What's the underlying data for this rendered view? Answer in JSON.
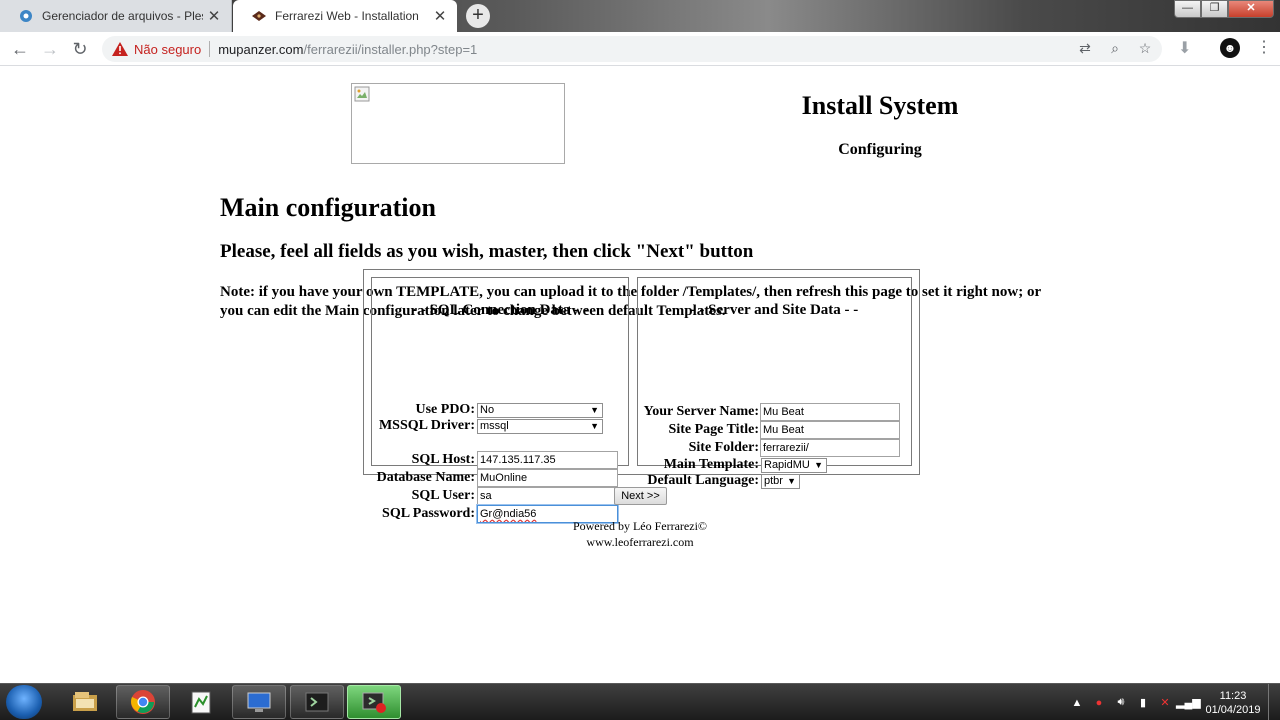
{
  "browser": {
    "tabs": [
      {
        "title": "Gerenciador de arquivos - Plesk O",
        "active": false
      },
      {
        "title": "Ferrarezi Web - Installation",
        "active": true
      }
    ],
    "new_tab": "+",
    "security_label": "Não seguro",
    "url_host": "mupanzer.com",
    "url_path": "/ferrarezii/installer.php?step=1"
  },
  "page": {
    "install_title": "Install System",
    "subtitle": "Configuring",
    "main_heading": "Main configuration",
    "sub_heading": "Please, feel all fields as you wish, master, then click \"Next\" button",
    "note": "Note: if you have your own TEMPLATE, you can upload it to the folder /Templates/, then refresh this page to set it right now; or you can edit the Main configuration later to change between default Templates.",
    "sql_panel": {
      "title": "- - SQL Connection Data - -",
      "use_pdo": {
        "label": "Use PDO:",
        "value": "No"
      },
      "mssql_driver": {
        "label": "MSSQL Driver:",
        "value": "mssql"
      },
      "sql_host": {
        "label": "SQL Host:",
        "value": "147.135.117.35"
      },
      "database_name": {
        "label": "Database Name:",
        "value": "MuOnline"
      },
      "sql_user": {
        "label": "SQL User:",
        "value": "sa"
      },
      "sql_password": {
        "label": "SQL Password:",
        "value": "Gr@ndia56"
      }
    },
    "server_panel": {
      "title": "- - Server and Site Data - -",
      "server_name": {
        "label": "Your Server Name:",
        "value": "Mu Beat"
      },
      "page_title": {
        "label": "Site Page Title:",
        "value": "Mu Beat"
      },
      "site_folder": {
        "label": "Site Folder:",
        "value": "ferrarezii/"
      },
      "main_template": {
        "label": "Main Template:",
        "value": "RapidMU"
      },
      "default_language": {
        "label": "Default Language:",
        "value": "ptbr"
      }
    },
    "next_button": "Next >>",
    "powered_by": "Powered by Léo Ferrarezi©",
    "website": "www.leoferrarezi.com"
  },
  "taskbar": {
    "time": "11:23",
    "date": "01/04/2019"
  },
  "colors": {
    "insecure_red": "#c5221f",
    "focus_blue": "#4a90d9",
    "active_task_green": "#2f8f2f"
  }
}
